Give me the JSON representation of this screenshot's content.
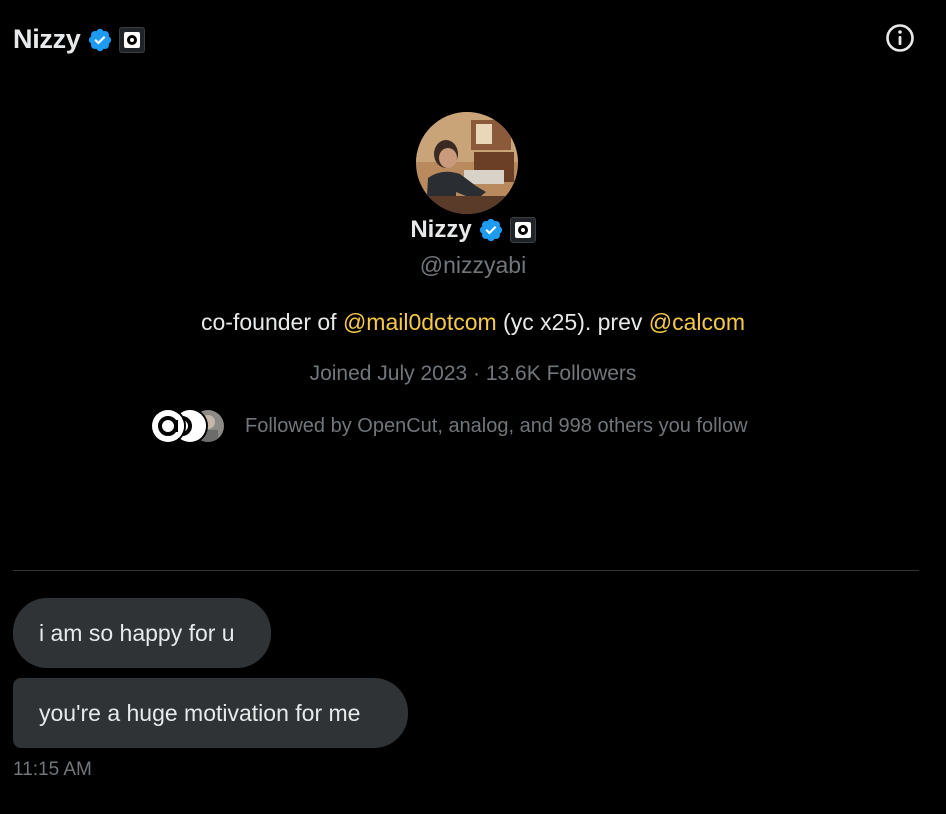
{
  "header": {
    "name": "Nizzy",
    "verified_badge": "verified-badge-icon",
    "affiliate_badge": "affiliate-logo-icon",
    "info_icon": "info-icon"
  },
  "profile": {
    "name": "Nizzy",
    "handle": "@nizzyabi",
    "bio": {
      "prefix": "co-founder of ",
      "mention1": "@mail0dotcom",
      "middle": " (yc x25). prev ",
      "mention2": "@calcom"
    },
    "joined": "Joined July 2023",
    "separator": " · ",
    "followers": "13.6K Followers",
    "followed_by": "Followed by OpenCut, analog, and 998 others you follow"
  },
  "messages": [
    {
      "text": "i am so happy for u"
    },
    {
      "text": "you're a huge motivation for me"
    }
  ],
  "timestamp": "11:15 AM",
  "colors": {
    "background": "#000000",
    "bubble": "#2f3336",
    "mention": "#f7c948",
    "verified": "#1d9bf0",
    "muted": "#71767b"
  }
}
